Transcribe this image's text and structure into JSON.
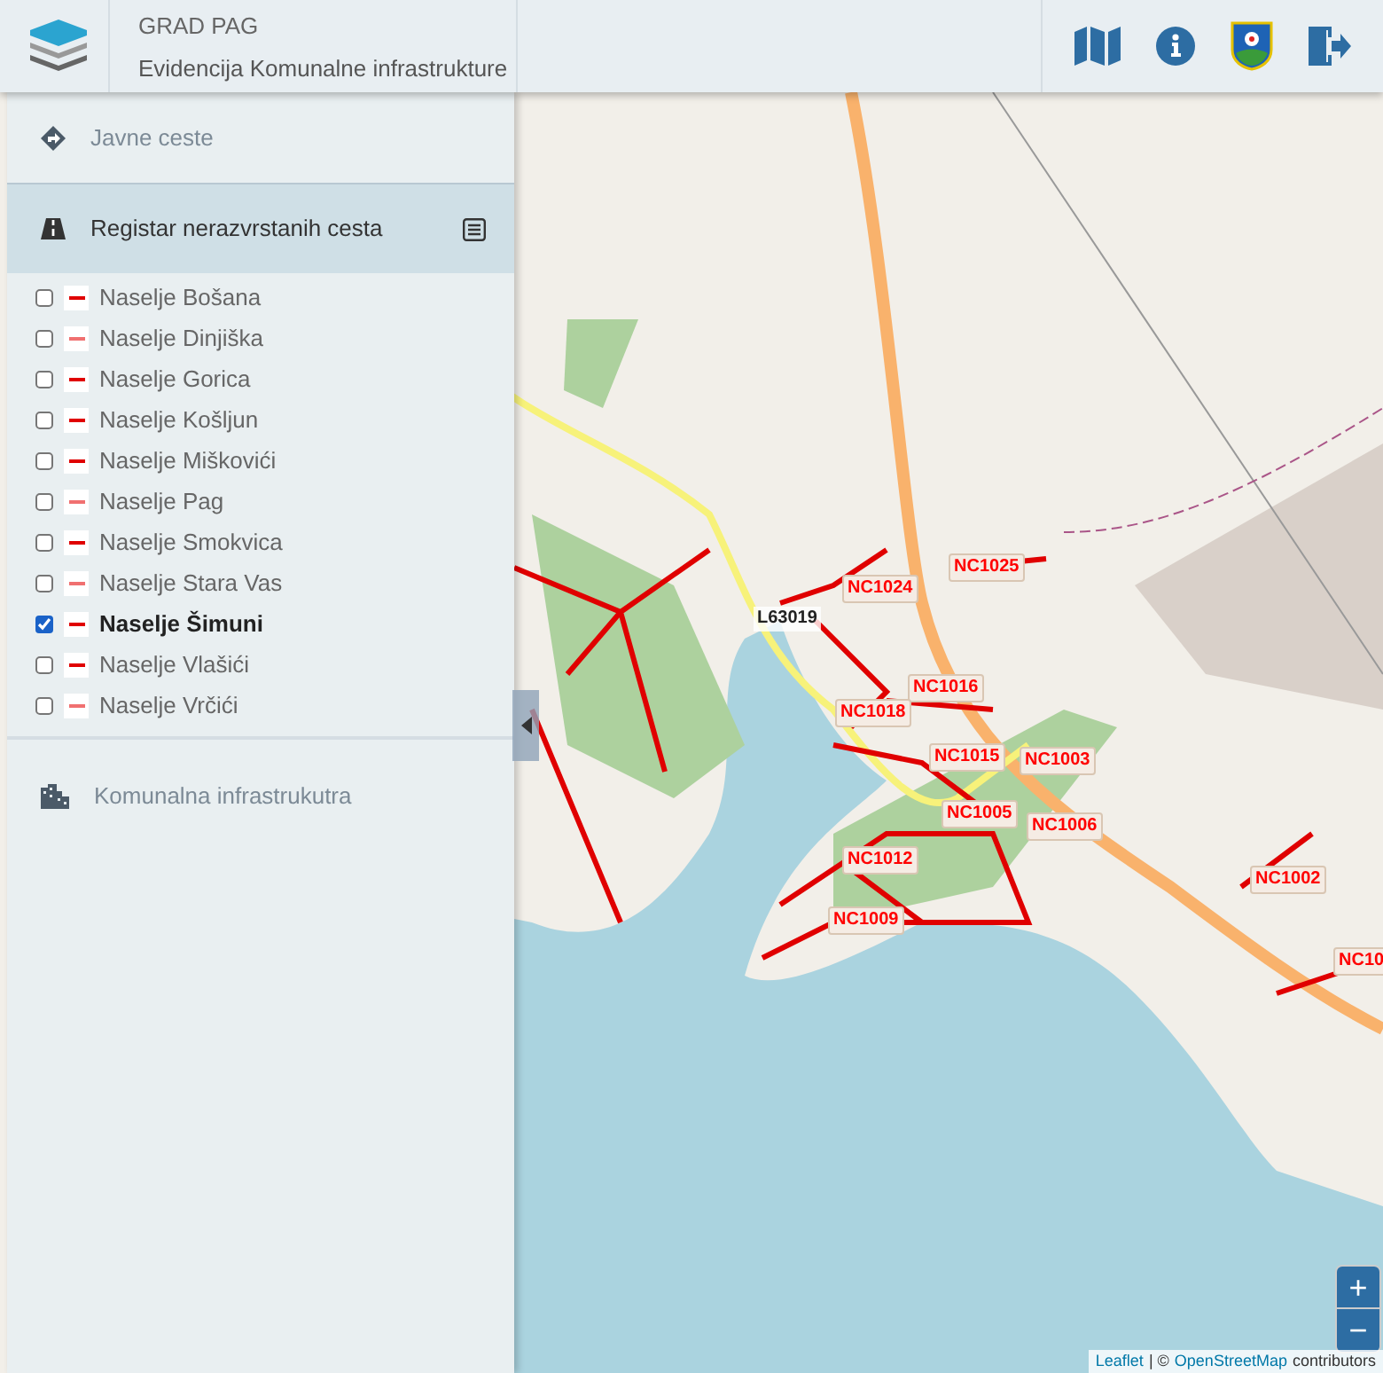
{
  "header": {
    "title": "GRAD PAG",
    "subtitle": "Evidencija Komunalne infrastrukture"
  },
  "sidebar": {
    "sections": [
      {
        "label": "Javne ceste",
        "selected": false,
        "kind": "roads"
      },
      {
        "label": "Registar nerazvrstanih cesta",
        "selected": true,
        "kind": "register"
      },
      {
        "label": "Komunalna infrastrukutra",
        "selected": false,
        "kind": "utilities"
      }
    ],
    "layers": [
      {
        "label": "Naselje Bošana",
        "checked": false,
        "color": "#e00000"
      },
      {
        "label": "Naselje Dinjiška",
        "checked": false,
        "color": "#f07070"
      },
      {
        "label": "Naselje Gorica",
        "checked": false,
        "color": "#e00000"
      },
      {
        "label": "Naselje Košljun",
        "checked": false,
        "color": "#e00000"
      },
      {
        "label": "Naselje Miškovići",
        "checked": false,
        "color": "#e00000"
      },
      {
        "label": "Naselje Pag",
        "checked": false,
        "color": "#f07070"
      },
      {
        "label": "Naselje Smokvica",
        "checked": false,
        "color": "#e00000"
      },
      {
        "label": "Naselje Stara Vas",
        "checked": false,
        "color": "#f07070"
      },
      {
        "label": "Naselje Šimuni",
        "checked": true,
        "color": "#e00000"
      },
      {
        "label": "Naselje Vlašići",
        "checked": false,
        "color": "#e00000"
      },
      {
        "label": "Naselje Vrčići",
        "checked": false,
        "color": "#f07070"
      }
    ]
  },
  "map": {
    "labels": [
      {
        "text": "NC1025",
        "kind": "nc"
      },
      {
        "text": "NC1024",
        "kind": "nc"
      },
      {
        "text": "L63019",
        "kind": "local"
      },
      {
        "text": "NC1016",
        "kind": "nc"
      },
      {
        "text": "NC1018",
        "kind": "nc"
      },
      {
        "text": "NC1015",
        "kind": "nc"
      },
      {
        "text": "NC1003",
        "kind": "nc"
      },
      {
        "text": "NC1005",
        "kind": "nc"
      },
      {
        "text": "NC1006",
        "kind": "nc"
      },
      {
        "text": "NC1012",
        "kind": "nc"
      },
      {
        "text": "NC1002",
        "kind": "nc"
      },
      {
        "text": "NC1009",
        "kind": "nc"
      },
      {
        "text": "NC10",
        "kind": "nc"
      }
    ],
    "zoom_in": "+",
    "zoom_out": "−",
    "attribution": {
      "link1": "Leaflet",
      "separator": "| ©",
      "link2": "OpenStreetMap",
      "suffix": "contributors"
    }
  }
}
